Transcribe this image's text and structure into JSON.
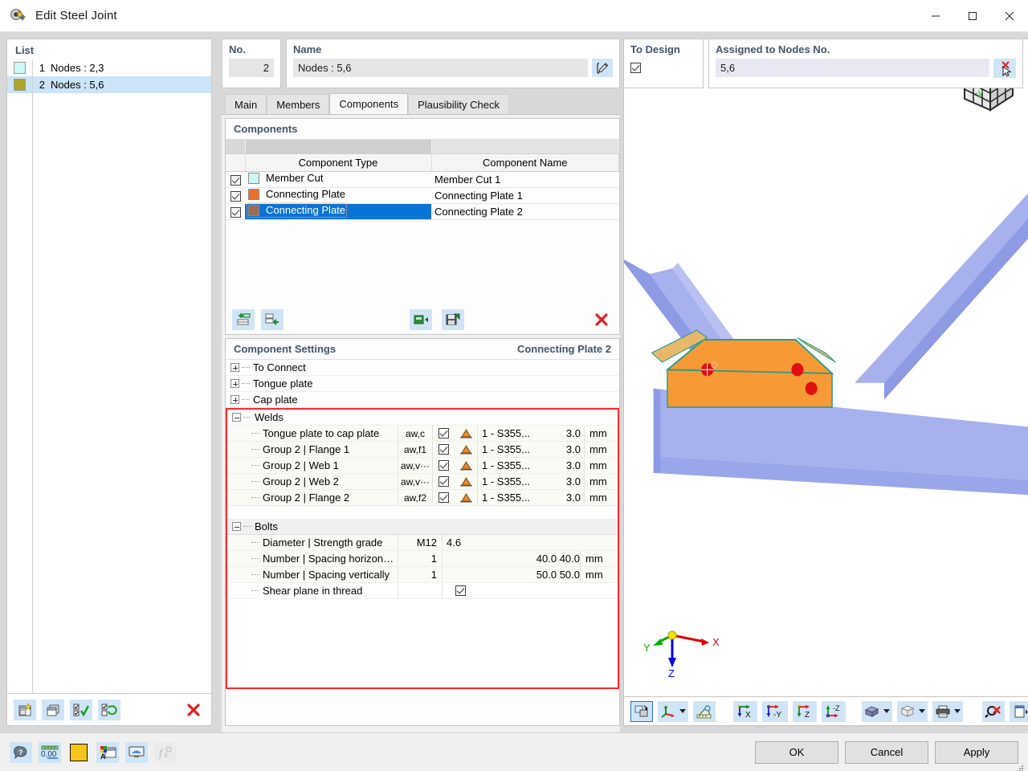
{
  "window": {
    "title": "Edit Steel Joint",
    "app_icon": "steel-joint-icon",
    "minimize": "–",
    "maximize": "□",
    "close": "✕"
  },
  "list_panel": {
    "caption": "List",
    "items": [
      {
        "index": "1",
        "label": "Nodes : 2,3",
        "color": "#ccf7f7",
        "selected": false
      },
      {
        "index": "2",
        "label": "Nodes : 5,6",
        "color": "#aaa62a",
        "selected": true
      }
    ],
    "toolbar": [
      {
        "name": "new-joint-button",
        "icon": "new-window-icon"
      },
      {
        "name": "copy-joint-button",
        "icon": "copy-window-icon"
      },
      {
        "name": "select-all-button",
        "icon": "check-all-icon"
      },
      {
        "name": "invert-selection-button",
        "icon": "invert-check-icon"
      },
      {
        "name": "delete-joint-button",
        "icon": "red-x-icon"
      }
    ]
  },
  "header": {
    "no_label": "No.",
    "no_value": "2",
    "name_label": "Name",
    "name_value": "Nodes : 5,6",
    "name_edit_icon": "pencil-edit-icon",
    "to_design_label": "To Design",
    "to_design_checked": true,
    "assigned_label": "Assigned to Nodes No.",
    "assigned_value": "5,6",
    "assigned_pick_icon": "pick-nodes-cursor-icon"
  },
  "tabs": [
    {
      "label": "Main",
      "active": false
    },
    {
      "label": "Members",
      "active": false
    },
    {
      "label": "Components",
      "active": true
    },
    {
      "label": "Plausibility Check",
      "active": false
    }
  ],
  "components": {
    "title": "Components",
    "columns": [
      "",
      "",
      "Component Type",
      "Component Name"
    ],
    "rows": [
      {
        "checked": true,
        "color": "#ccf7f7",
        "type": "Member Cut",
        "name": "Member Cut 1",
        "selected": false
      },
      {
        "checked": true,
        "color": "#e8702a",
        "type": "Connecting Plate",
        "name": "Connecting Plate 1",
        "selected": false
      },
      {
        "checked": true,
        "color": "#9a6b52",
        "type": "Connecting Plate",
        "name": "Connecting Plate 2",
        "selected": true
      }
    ],
    "toolbar": [
      {
        "name": "move-component-left-button",
        "icon": "arrow-left-rows-icon"
      },
      {
        "name": "move-component-up-button",
        "icon": "arrow-left-rows-2-icon"
      },
      {
        "name": "import-component-button",
        "icon": "green-import-icon"
      },
      {
        "name": "save-component-button",
        "icon": "green-save-icon"
      },
      {
        "name": "delete-component-button",
        "icon": "red-x-icon"
      }
    ]
  },
  "settings": {
    "title": "Component Settings",
    "subject": "Connecting Plate 2",
    "groups": [
      {
        "label": "To Connect",
        "expanded": false
      },
      {
        "label": "Tongue plate",
        "expanded": false
      },
      {
        "label": "Cap plate",
        "expanded": false
      }
    ],
    "welds": {
      "label": "Welds",
      "expanded": true,
      "rows": [
        {
          "label": "Tongue plate to cap plate",
          "symbol": "aw,c",
          "checked": true,
          "icon": "weld-fillet-icon",
          "material": "1 - S355...",
          "value": "3.0",
          "unit": "mm"
        },
        {
          "label": "Group 2 | Flange 1",
          "symbol": "aw,f1",
          "checked": true,
          "icon": "weld-fillet-icon",
          "material": "1 - S355...",
          "value": "3.0",
          "unit": "mm"
        },
        {
          "label": "Group 2 | Web 1",
          "symbol": "aw,v···",
          "checked": true,
          "icon": "weld-fillet-icon",
          "material": "1 - S355...",
          "value": "3.0",
          "unit": "mm"
        },
        {
          "label": "Group 2 | Web 2",
          "symbol": "aw,v···",
          "checked": true,
          "icon": "weld-fillet-icon",
          "material": "1 - S355...",
          "value": "3.0",
          "unit": "mm"
        },
        {
          "label": "Group 2 | Flange 2",
          "symbol": "aw,f2",
          "checked": true,
          "icon": "weld-fillet-icon",
          "material": "1 - S355...",
          "value": "3.0",
          "unit": "mm"
        }
      ]
    },
    "bolts": {
      "label": "Bolts",
      "expanded": true,
      "rows": [
        {
          "label": "Diameter | Strength grade",
          "c1": "M12",
          "c2": "4.6",
          "c3": "",
          "unit": "",
          "checkbox": false
        },
        {
          "label": "Number | Spacing horizon…",
          "c1": "1",
          "c2": "",
          "c3": "40.0 40.0",
          "unit": "mm",
          "checkbox": false
        },
        {
          "label": "Number | Spacing vertically",
          "c1": "1",
          "c2": "",
          "c3": "50.0 50.0",
          "unit": "mm",
          "checkbox": false
        },
        {
          "label": "Shear plane in thread",
          "c1": "",
          "c2": "",
          "c3": "",
          "unit": "",
          "checkbox": true,
          "checked": true
        }
      ]
    },
    "highlight_color": "#ff2b2b"
  },
  "viewport": {
    "nav_cube": "navigation-cube",
    "nav_cube_faces": {
      "front": "-y",
      "right": "x",
      "top": "z"
    },
    "axes": {
      "x": "X",
      "y": "Y",
      "z": "Z",
      "x_color": "#e00000",
      "y_color": "#00b000",
      "z_color": "#0000e0"
    },
    "colors": {
      "member": "#9aa6f0",
      "plate": "#f79a36",
      "bolt": "#e01010"
    },
    "toolbar": [
      {
        "name": "rotate-view-button",
        "icon": "rotate-view-icon",
        "selected": true
      },
      {
        "name": "view-axes-button",
        "icon": "axes-icon",
        "dropdown": true
      },
      {
        "name": "measure-button",
        "icon": "ruler-protractor-icon"
      },
      {
        "name": "view-in-x-button",
        "icon": "view-x-icon"
      },
      {
        "name": "view-in-minus-y-button",
        "icon": "view-minus-y-icon"
      },
      {
        "name": "view-in-z-button",
        "icon": "view-z-icon"
      },
      {
        "name": "view-in-minus-z-button",
        "icon": "view-minus-z-icon"
      },
      {
        "name": "render-mode-button",
        "icon": "solid-model-icon",
        "dropdown": true
      },
      {
        "name": "wireframe-mode-button",
        "icon": "wireframe-cube-icon",
        "dropdown": true
      },
      {
        "name": "print-button",
        "icon": "printer-icon",
        "dropdown": true
      },
      {
        "name": "clear-zoom-button",
        "icon": "zoom-reset-icon"
      },
      {
        "name": "panel-toggle-button",
        "icon": "panel-toggle-icon"
      }
    ]
  },
  "bottom_toolbar": [
    {
      "name": "help-button",
      "icon": "help-bubble-icon"
    },
    {
      "name": "units-button",
      "icon": "units-000-icon"
    },
    {
      "name": "color-button",
      "icon": "yellow-color-icon",
      "color": "#f5c518"
    },
    {
      "name": "display-properties-button",
      "icon": "colors-dialog-icon"
    },
    {
      "name": "visual-settings-button",
      "icon": "monitor-icon"
    },
    {
      "name": "formula-button",
      "icon": "fx-icon",
      "disabled": true
    }
  ],
  "footer_buttons": [
    {
      "label": "OK",
      "name": "ok-button"
    },
    {
      "label": "Cancel",
      "name": "cancel-button"
    },
    {
      "label": "Apply",
      "name": "apply-button"
    }
  ]
}
